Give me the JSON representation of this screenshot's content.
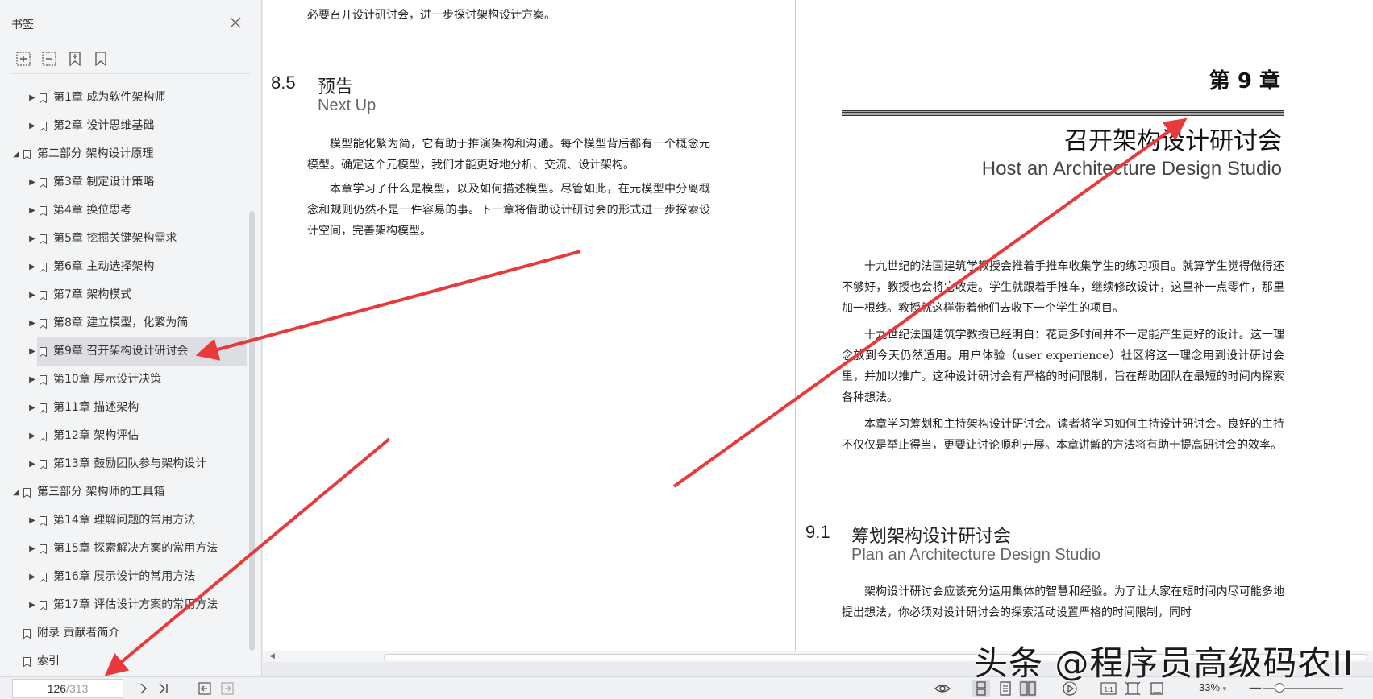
{
  "sidebar": {
    "title": "书签",
    "tree": [
      {
        "label": "第1章  成为软件架构师",
        "level": 1,
        "expanded": false
      },
      {
        "label": "第2章  设计思维基础",
        "level": 1,
        "expanded": false
      },
      {
        "label": "第二部分  架构设计原理",
        "level": 0,
        "expanded": true
      },
      {
        "label": "第3章  制定设计策略",
        "level": 1,
        "expanded": false
      },
      {
        "label": "第4章  换位思考",
        "level": 1,
        "expanded": false
      },
      {
        "label": "第5章  挖掘关键架构需求",
        "level": 1,
        "expanded": false
      },
      {
        "label": "第6章  主动选择架构",
        "level": 1,
        "expanded": false
      },
      {
        "label": "第7章  架构模式",
        "level": 1,
        "expanded": false
      },
      {
        "label": "第8章  建立模型，化繁为简",
        "level": 1,
        "expanded": false
      },
      {
        "label": "第9章  召开架构设计研讨会",
        "level": 1,
        "expanded": false,
        "selected": true
      },
      {
        "label": "第10章  展示设计决策",
        "level": 1,
        "expanded": false
      },
      {
        "label": "第11章  描述架构",
        "level": 1,
        "expanded": false
      },
      {
        "label": "第12章  架构评估",
        "level": 1,
        "expanded": false
      },
      {
        "label": "第13章  鼓励团队参与架构设计",
        "level": 1,
        "expanded": false
      },
      {
        "label": "第三部分  架构师的工具箱",
        "level": 0,
        "expanded": true
      },
      {
        "label": "第14章  理解问题的常用方法",
        "level": 1,
        "expanded": false
      },
      {
        "label": "第15章  探索解决方案的常用方法",
        "level": 1,
        "expanded": false
      },
      {
        "label": "第16章  展示设计的常用方法",
        "level": 1,
        "expanded": false
      },
      {
        "label": "第17章  评估设计方案的常用方法",
        "level": 1,
        "expanded": false
      },
      {
        "label": "附录  贡献者简介",
        "level": 0,
        "leaf": true
      },
      {
        "label": "索引",
        "level": 0,
        "leaf": true
      }
    ]
  },
  "document": {
    "left_page": {
      "prev_line": "必要召开设计研讨会，进一步探讨架构设计方案。",
      "section_number": "8.5",
      "section_title_cn": "预告",
      "section_title_en": "Next Up",
      "paragraphs": [
        "模型能化繁为简，它有助于推演架构和沟通。每个模型背后都有一个概念元模型。确定这个元模型，我们才能更好地分析、交流、设计架构。",
        "本章学习了什么是模型，以及如何描述模型。尽管如此，在元模型中分离概念和规则仍然不是一件容易的事。下一章将借助设计研讨会的形式进一步探索设计空间，完善架构模型。"
      ]
    },
    "right_page": {
      "chapter_label": "第 9 章",
      "chapter_title_cn": "召开架构设计研讨会",
      "chapter_title_en": "Host an Architecture Design Studio",
      "intro_paragraphs": [
        "十九世纪的法国建筑学教授会推着手推车收集学生的练习项目。就算学生觉得做得还不够好，教授也会将它收走。学生就跟着手推车，继续修改设计，这里补一点零件，那里加一根线。教授就这样带着他们去收下一个学生的项目。",
        "十九世纪法国建筑学教授已经明白：花更多时间并不一定能产生更好的设计。这一理念放到今天仍然适用。用户体验（user experience）社区将这一理念用到设计研讨会里，并加以推广。这种设计研讨会有严格的时间限制，旨在帮助团队在最短的时间内探索各种想法。",
        "本章学习筹划和主持架构设计研讨会。读者将学习如何主持设计研讨会。良好的主持不仅仅是举止得当，更要让讨论顺利开展。本章讲解的方法将有助于提高研讨会的效率。"
      ],
      "section_number": "9.1",
      "section_title_cn": "筹划架构设计研讨会",
      "section_title_en": "Plan an Architecture Design Studio",
      "section_paragraph": "架构设计研讨会应该充分运用集体的智慧和经验。为了让大家在短时间内尽可能多地提出想法，你必须对设计研讨会的探索活动设置严格的时间限制，同时"
    }
  },
  "statusbar": {
    "current_page": "126",
    "total_pages": "/313",
    "zoom": "33%",
    "zoom_caret": "▾"
  },
  "watermark": "头条 @程序员高级码农II",
  "colors": {
    "arrow": "#e8393b",
    "sidebar_bg": "#f3f4f6",
    "selected_row": "#dcdee3"
  }
}
